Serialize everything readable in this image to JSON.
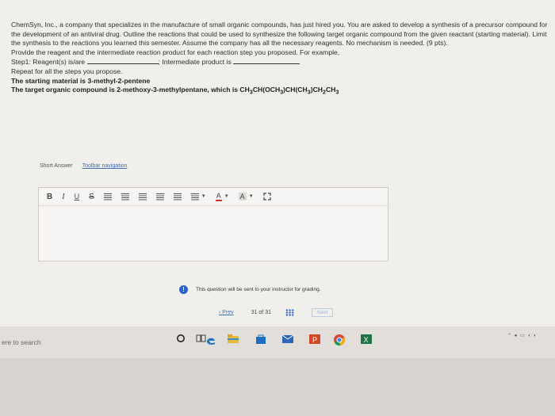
{
  "question": {
    "paragraph": "ChemSyn, Inc., a company that specializes in the manufacture of small organic compounds, has just hired you. You are asked to develop a synthesis of a precursor compound for the development of an antiviral drug. Outline the reactions that could be used to synthesize the following target organic compound from the given reactant (starting material). Limit the synthesis to the reactions you learned this semester. Assume the company has all the necessary reagents. No mechanism is needed. (9 pts).",
    "instruction": "Provide the reagent and the intermediate reaction product for each reaction step you proposed. For example,",
    "step_prefix": "Step1: Reagent(s) is/are",
    "step_middle": "; Intermediate product is",
    "repeat": "Repeat for all the steps you propose.",
    "starting": "The starting material is 3-methyl-2-pentene",
    "target_prefix": "The target organic compound is 2-methoxy-3-methylpentane, which is CH",
    "target_sub1": "3",
    "target_mid1": "CH(OCH",
    "target_sub2": "3",
    "target_mid2": ")CH(CH",
    "target_sub3": "3",
    "target_mid3": ")CH",
    "target_sub4": "2",
    "target_mid4": "CH",
    "target_sub5": "3"
  },
  "answer": {
    "label": "Short Answer",
    "toolbar_nav": "Toolbar navigation",
    "toolbar": {
      "bold": "B",
      "italic": "I",
      "underline": "U",
      "strike": "S",
      "font_color": "A",
      "highlight": "A"
    }
  },
  "notice": {
    "icon": "!",
    "text": "This question will be sent to your instructor for grading."
  },
  "pager": {
    "prev": "Prev",
    "count": "31 of 31",
    "next": "Next"
  },
  "taskbar": {
    "search": "ere to search"
  }
}
